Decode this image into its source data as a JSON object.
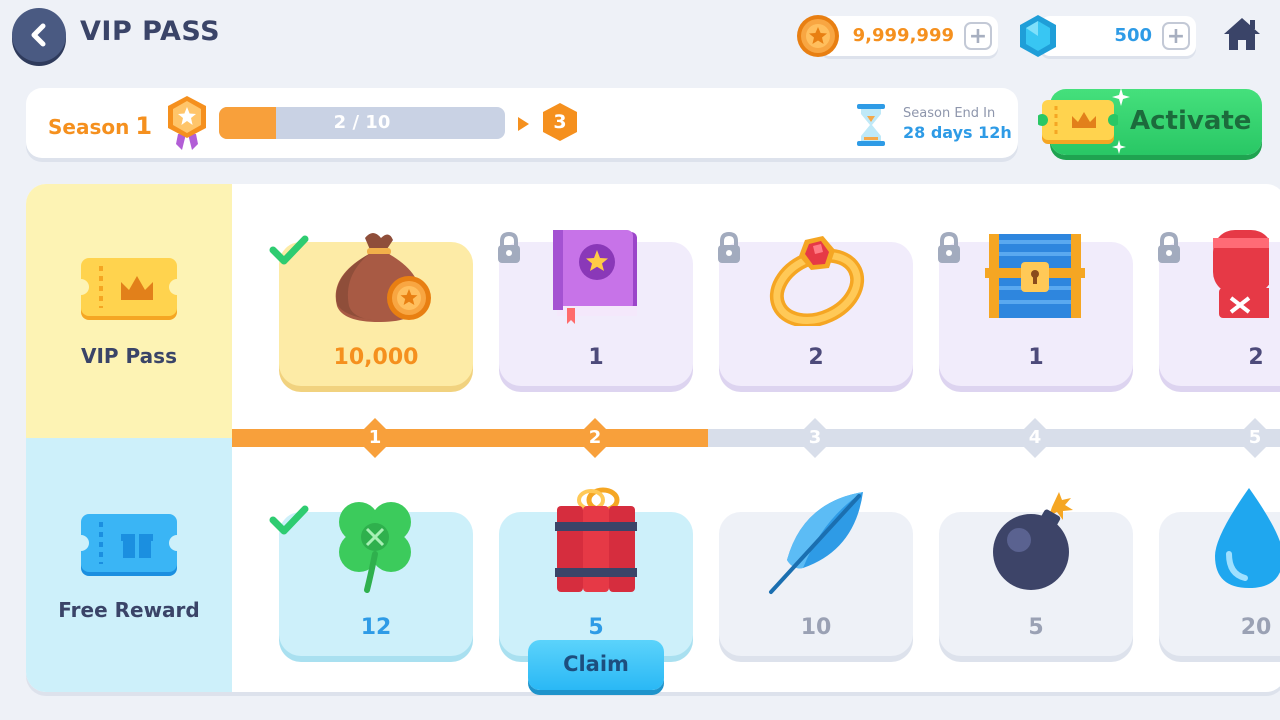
{
  "header": {
    "title": "VIP PASS",
    "coins": "9,999,999",
    "gems": "500",
    "plus": "+"
  },
  "season": {
    "label": "Season",
    "number": "1",
    "progress_text": "2 / 10",
    "progress_fraction": 0.2,
    "next_level": "3",
    "end_label": "Season End In",
    "end_value": "28 days 12h"
  },
  "activate_label": "Activate",
  "rows": {
    "vip_label": "VIP Pass",
    "free_label": "Free Reward"
  },
  "vip_rewards": [
    {
      "value": "10,000",
      "icon": "coin-bag-icon",
      "state": "claimed"
    },
    {
      "value": "1",
      "icon": "star-book-icon",
      "state": "locked"
    },
    {
      "value": "2",
      "icon": "ruby-ring-icon",
      "state": "locked"
    },
    {
      "value": "1",
      "icon": "treasure-chest-icon",
      "state": "locked"
    },
    {
      "value": "2",
      "icon": "boxing-glove-icon",
      "state": "locked"
    }
  ],
  "levels": [
    "1",
    "2",
    "3",
    "4",
    "5"
  ],
  "free_rewards": [
    {
      "value": "12",
      "icon": "clover-icon",
      "state": "claimed"
    },
    {
      "value": "5",
      "icon": "dynamite-icon",
      "state": "claimable"
    },
    {
      "value": "10",
      "icon": "feather-icon",
      "state": "locked"
    },
    {
      "value": "5",
      "icon": "bomb-icon",
      "state": "locked"
    },
    {
      "value": "20",
      "icon": "water-drop-icon",
      "state": "locked"
    }
  ],
  "claim_label": "Claim",
  "colors": {
    "orange": "#f5901e",
    "green": "#29c765",
    "blue": "#2e9be6",
    "navy": "#3a4468"
  }
}
